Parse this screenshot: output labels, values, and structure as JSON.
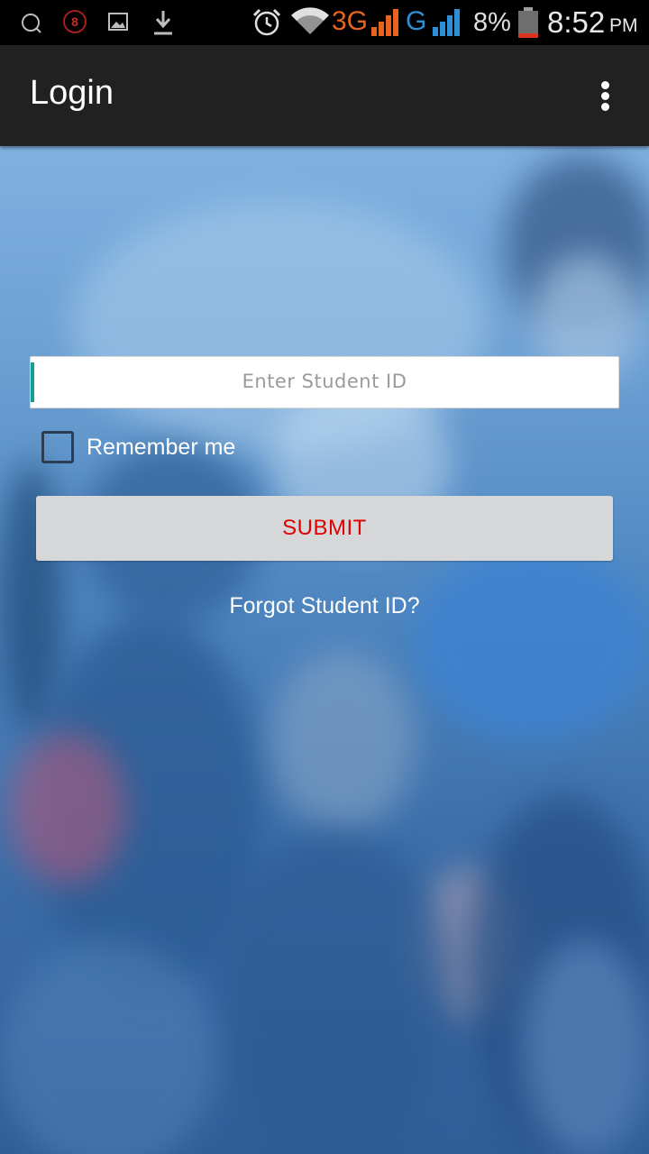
{
  "status_bar": {
    "notification_badge": "8",
    "network_3g": "3G",
    "network_g": "G",
    "battery": "8%",
    "time": "8:52",
    "ampm": "PM",
    "colors": {
      "network_3g": "#e8641e",
      "network_g": "#2d8fd6",
      "battery": "#d9341d"
    }
  },
  "app_bar": {
    "title": "Login",
    "overflow_icon": "more-vert-icon"
  },
  "form": {
    "student_id": {
      "value": "",
      "placeholder": "Enter Student ID"
    },
    "remember_label": "Remember me",
    "remember_checked": false,
    "submit_label": "SUBMIT",
    "forgot_label": "Forgot Student ID?"
  },
  "colors": {
    "app_bar": "#212121",
    "submit_text": "#e00000",
    "input_accent": "#1a9e8c"
  }
}
